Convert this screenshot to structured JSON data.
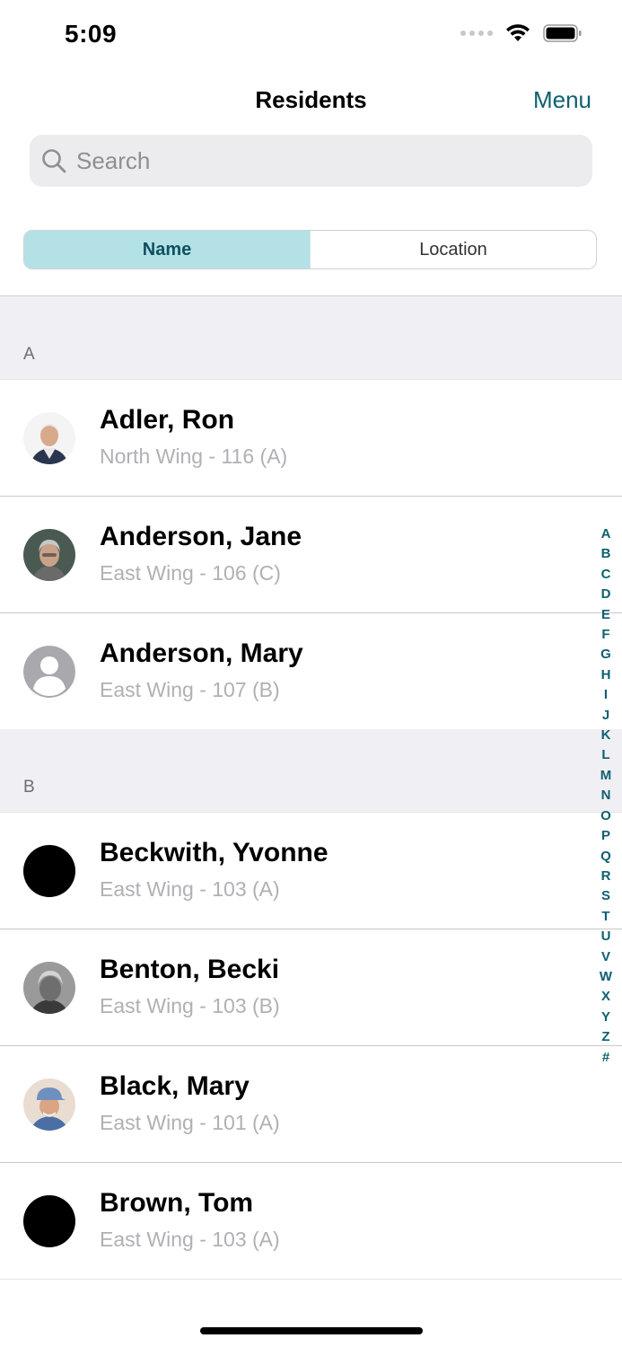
{
  "status_bar": {
    "time": "5:09"
  },
  "nav": {
    "title": "Residents",
    "menu_label": "Menu"
  },
  "search": {
    "placeholder": "Search",
    "value": ""
  },
  "segments": [
    {
      "label": "Name",
      "selected": true
    },
    {
      "label": "Location",
      "selected": false
    }
  ],
  "sections": [
    {
      "letter": "A",
      "residents": [
        {
          "name": "Adler, Ron",
          "location": "North Wing - 116 (A)",
          "avatar": "photo-man-white-hair"
        },
        {
          "name": "Anderson, Jane",
          "location": "East Wing - 106 (C)",
          "avatar": "photo-woman-grey-hair"
        },
        {
          "name": "Anderson, Mary",
          "location": "East Wing - 107 (B)",
          "avatar": "placeholder-person-icon"
        }
      ]
    },
    {
      "letter": "B",
      "residents": [
        {
          "name": "Beckwith, Yvonne",
          "location": "East Wing - 103 (A)",
          "avatar": "black-circle"
        },
        {
          "name": "Benton, Becki",
          "location": "East Wing - 103 (B)",
          "avatar": "photo-woman-bw"
        },
        {
          "name": "Black, Mary",
          "location": "East Wing - 101 (A)",
          "avatar": "photo-man-cap"
        },
        {
          "name": "Brown, Tom",
          "location": "East Wing - 103 (A)",
          "avatar": "black-circle"
        }
      ]
    }
  ],
  "index_letters": [
    "A",
    "B",
    "C",
    "D",
    "E",
    "F",
    "G",
    "H",
    "I",
    "J",
    "K",
    "L",
    "M",
    "N",
    "O",
    "P",
    "Q",
    "R",
    "S",
    "T",
    "U",
    "V",
    "W",
    "X",
    "Y",
    "Z",
    "#"
  ],
  "colors": {
    "accent": "#0e6070",
    "segment_selected_bg": "#b3e1e6",
    "section_bg": "#efeff4",
    "secondary_text": "#b0b0b5"
  }
}
